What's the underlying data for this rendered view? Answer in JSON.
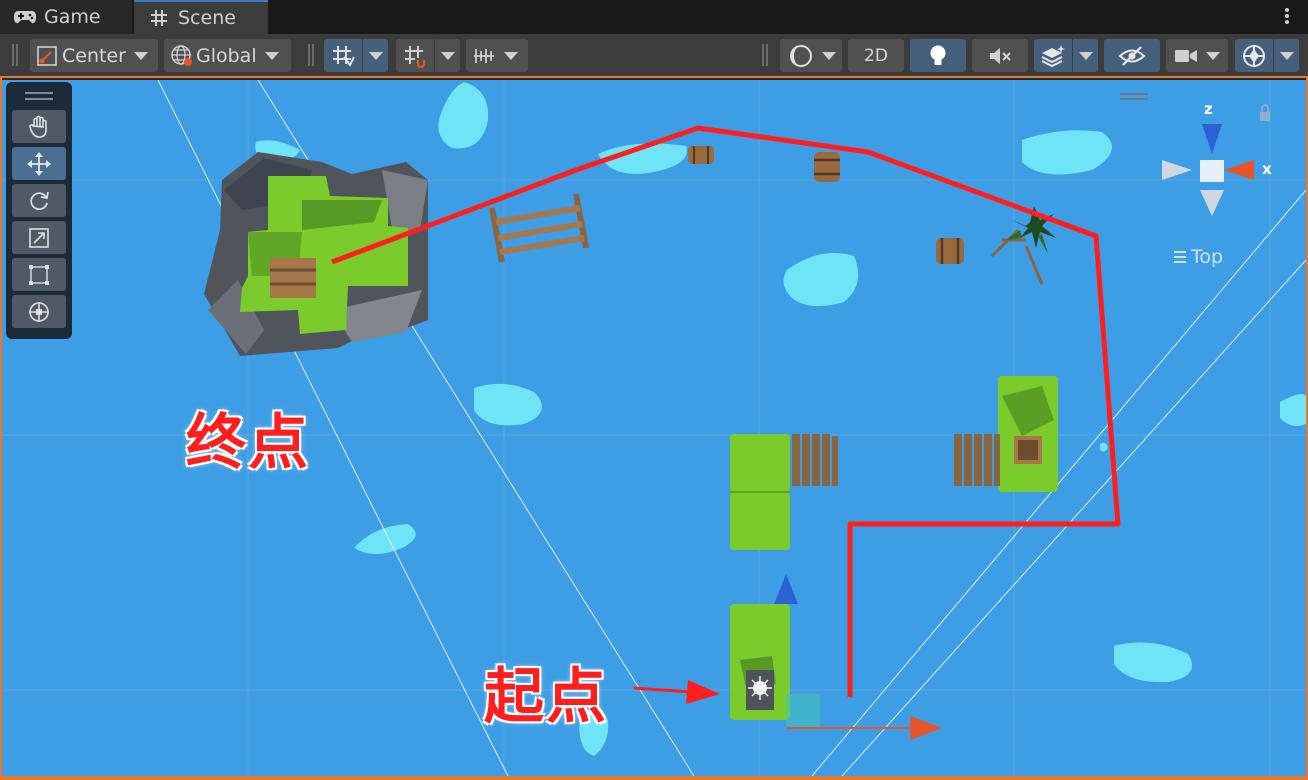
{
  "tabs": [
    {
      "label": "Game",
      "icon": "gamepad-icon"
    },
    {
      "label": "Scene",
      "icon": "grid-hash-icon"
    }
  ],
  "toolbar": {
    "pivot_label": "Center",
    "space_label": "Global",
    "mode_2d_label": "2D"
  },
  "tools": [
    "hand-tool",
    "move-tool",
    "rotate-tool",
    "scale-tool",
    "rect-tool",
    "transform-tool"
  ],
  "active_tool": "move-tool",
  "scene": {
    "end_label": "终点",
    "start_label": "起点",
    "view_label": "Top",
    "gizmo": {
      "z_label": "z",
      "x_label": "x"
    }
  },
  "colors": {
    "sky": "#3e9ee5",
    "path": "#ff1e1e",
    "grass": "#7ccb2c",
    "selection_border": "#e8792b"
  }
}
